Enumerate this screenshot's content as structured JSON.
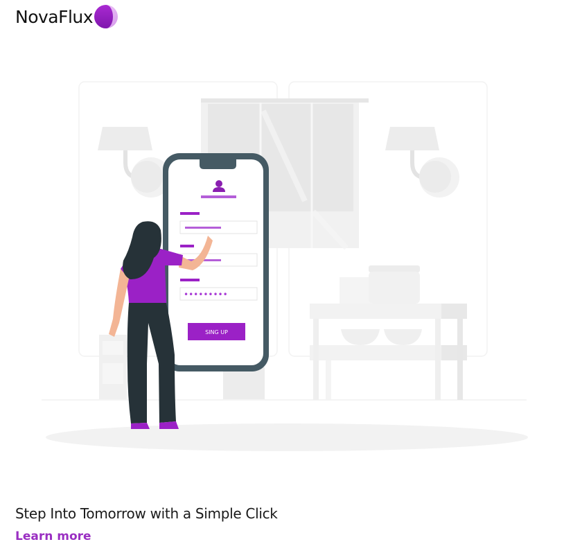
{
  "brand": {
    "name": "NovaFlux",
    "logo_icon": "crescent-moon-logo",
    "accent_color": "#9b21c6"
  },
  "illustration": {
    "phone_form": {
      "button_label": "SING UP",
      "password_mask": "•••••••••"
    }
  },
  "content": {
    "headline": "Step Into Tomorrow with a Simple Click",
    "link_label": "Learn more"
  }
}
